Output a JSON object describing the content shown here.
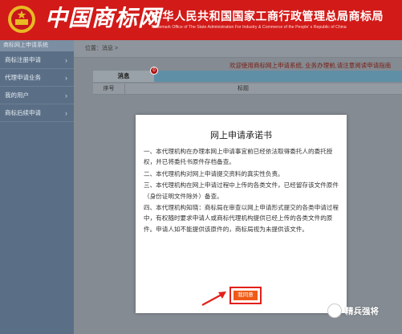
{
  "header": {
    "brand_logo": "中国商标网",
    "org_title": "中华人民共和国国家工商行政管理总局商标局",
    "org_subtitle": "Trademark Office of The State Administration For Industry & Commerce of the People' s Republic of China"
  },
  "sidebar": {
    "head": "商标网上申请系统",
    "items": [
      {
        "label": "商标注册申请"
      },
      {
        "label": "代理申请业务"
      },
      {
        "label": "我的用户"
      },
      {
        "label": "商标后续申请"
      }
    ]
  },
  "main": {
    "breadcrumb": "位置：消息 >",
    "notice": "欢迎使用商标网上申请系统, 业务办理前,请注意阅读申请指南",
    "tab_label": "消息",
    "tab_badge": "0",
    "table_headers": {
      "no": "序号",
      "title": "标题"
    }
  },
  "modal": {
    "title": "网上申请承诺书",
    "clauses": [
      "一、本代理机构在办理本网上申请事宜前已经依法取得委托人的委托授权，并已将委托书原件存档备查。",
      "二、本代理机构对网上申请提交资料的真实性负责。",
      "三、本代理机构在网上申请过程中上传的各类文件，已经留存该文件原件（身份证明文件除外）备查。",
      "四、本代理机构知晓：商标局在审查以网上申请形式提交的各类申请过程中，有权随时要求申请人或商标代理机构提供已经上传的各类文件的原件。申请人如不能提供该原件的，商标局视为未提供该文件。"
    ],
    "agree_label": "我同意"
  },
  "watermark": {
    "text": "精兵强将"
  },
  "colors": {
    "header_red": "#d21a18",
    "button_orange": "#f05a16",
    "highlight_red": "#e3201b"
  }
}
